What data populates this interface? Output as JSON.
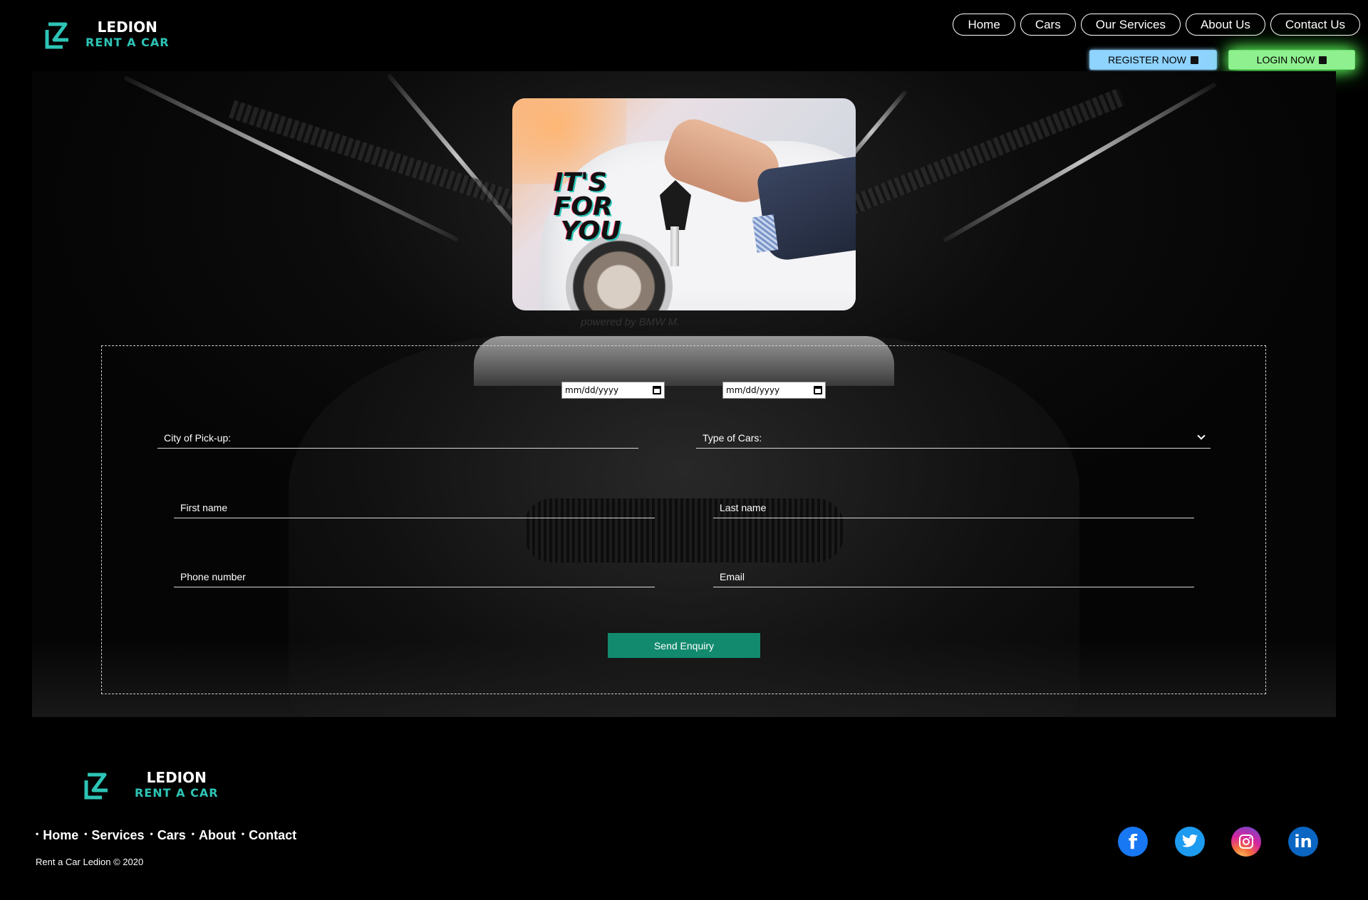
{
  "brand": {
    "line1": "LEDION",
    "line2": "RENT A CAR",
    "accent_color": "#2ec4b6"
  },
  "nav": {
    "items": [
      {
        "label": "Home"
      },
      {
        "label": "Cars"
      },
      {
        "label": "Our Services"
      },
      {
        "label": "About Us"
      },
      {
        "label": "Contact Us"
      }
    ]
  },
  "auth": {
    "register_label": "REGISTER NOW",
    "register_icon": "external-link-icon",
    "register_color": "#8fd3ff",
    "login_label": "LOGIN NOW",
    "login_icon": "sign-in-icon",
    "login_color": "#8ff08f"
  },
  "promo": {
    "slogan_line1": "IT'S",
    "slogan_line2": "FOR",
    "slogan_line3": "YOU"
  },
  "hero": {
    "windshield_text": "powered by  BMW M."
  },
  "form": {
    "pickup_date_placeholder": "mm/dd/yyyy",
    "return_date_placeholder": "mm/dd/yyyy",
    "city_placeholder": "City of Pick-up:",
    "car_type_selected": "Type of Cars:",
    "first_name_placeholder": "First name",
    "last_name_placeholder": "Last name",
    "phone_placeholder": "Phone number",
    "email_placeholder": "Email",
    "submit_label": "Send Enquiry",
    "submit_color": "#128a6e"
  },
  "footer": {
    "links": [
      {
        "label": "Home"
      },
      {
        "label": "Services"
      },
      {
        "label": "Cars"
      },
      {
        "label": "About"
      },
      {
        "label": "Contact"
      }
    ],
    "copyright": "Rent a Car Ledion © 2020",
    "social": [
      {
        "name": "facebook-icon",
        "color": "#1877f2"
      },
      {
        "name": "twitter-icon",
        "color": "#1d9bf0"
      },
      {
        "name": "instagram-icon",
        "color": "#d6249f"
      },
      {
        "name": "linkedin-icon",
        "color": "#0a66c2"
      }
    ]
  }
}
